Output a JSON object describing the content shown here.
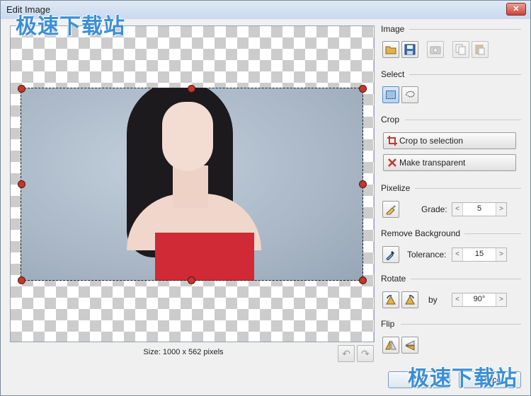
{
  "window": {
    "title": "Edit Image",
    "close_label": "✕"
  },
  "watermark": {
    "text": "极速下载站"
  },
  "canvas": {
    "size_label": "Size: 1000 x 562 pixels"
  },
  "undo": {
    "undo_icon": "undo-icon",
    "redo_icon": "redo-icon"
  },
  "panel": {
    "image": {
      "label": "Image",
      "buttons": [
        "open-icon",
        "save-icon",
        "camera-icon",
        "copy-icon",
        "paste-icon"
      ]
    },
    "select": {
      "label": "Select",
      "buttons": [
        "rect-select-icon",
        "lasso-select-icon"
      ]
    },
    "crop": {
      "label": "Crop",
      "crop_to_selection": "Crop to selection",
      "make_transparent": "Make transparent"
    },
    "pixelize": {
      "label": "Pixelize",
      "grade_label": "Grade:",
      "grade_value": "5"
    },
    "remove_background": {
      "label": "Remove Background",
      "tolerance_label": "Tolerance:",
      "tolerance_value": "15"
    },
    "rotate": {
      "label": "Rotate",
      "by_label": "by",
      "angle_value": "90°"
    },
    "flip": {
      "label": "Flip"
    }
  },
  "footer": {
    "ok_label": "OK",
    "cancel_label": "Cancel"
  },
  "colors": {
    "accent": "#3b8fd6",
    "handle": "#c0392b",
    "crop_icon": "#c0392b"
  }
}
